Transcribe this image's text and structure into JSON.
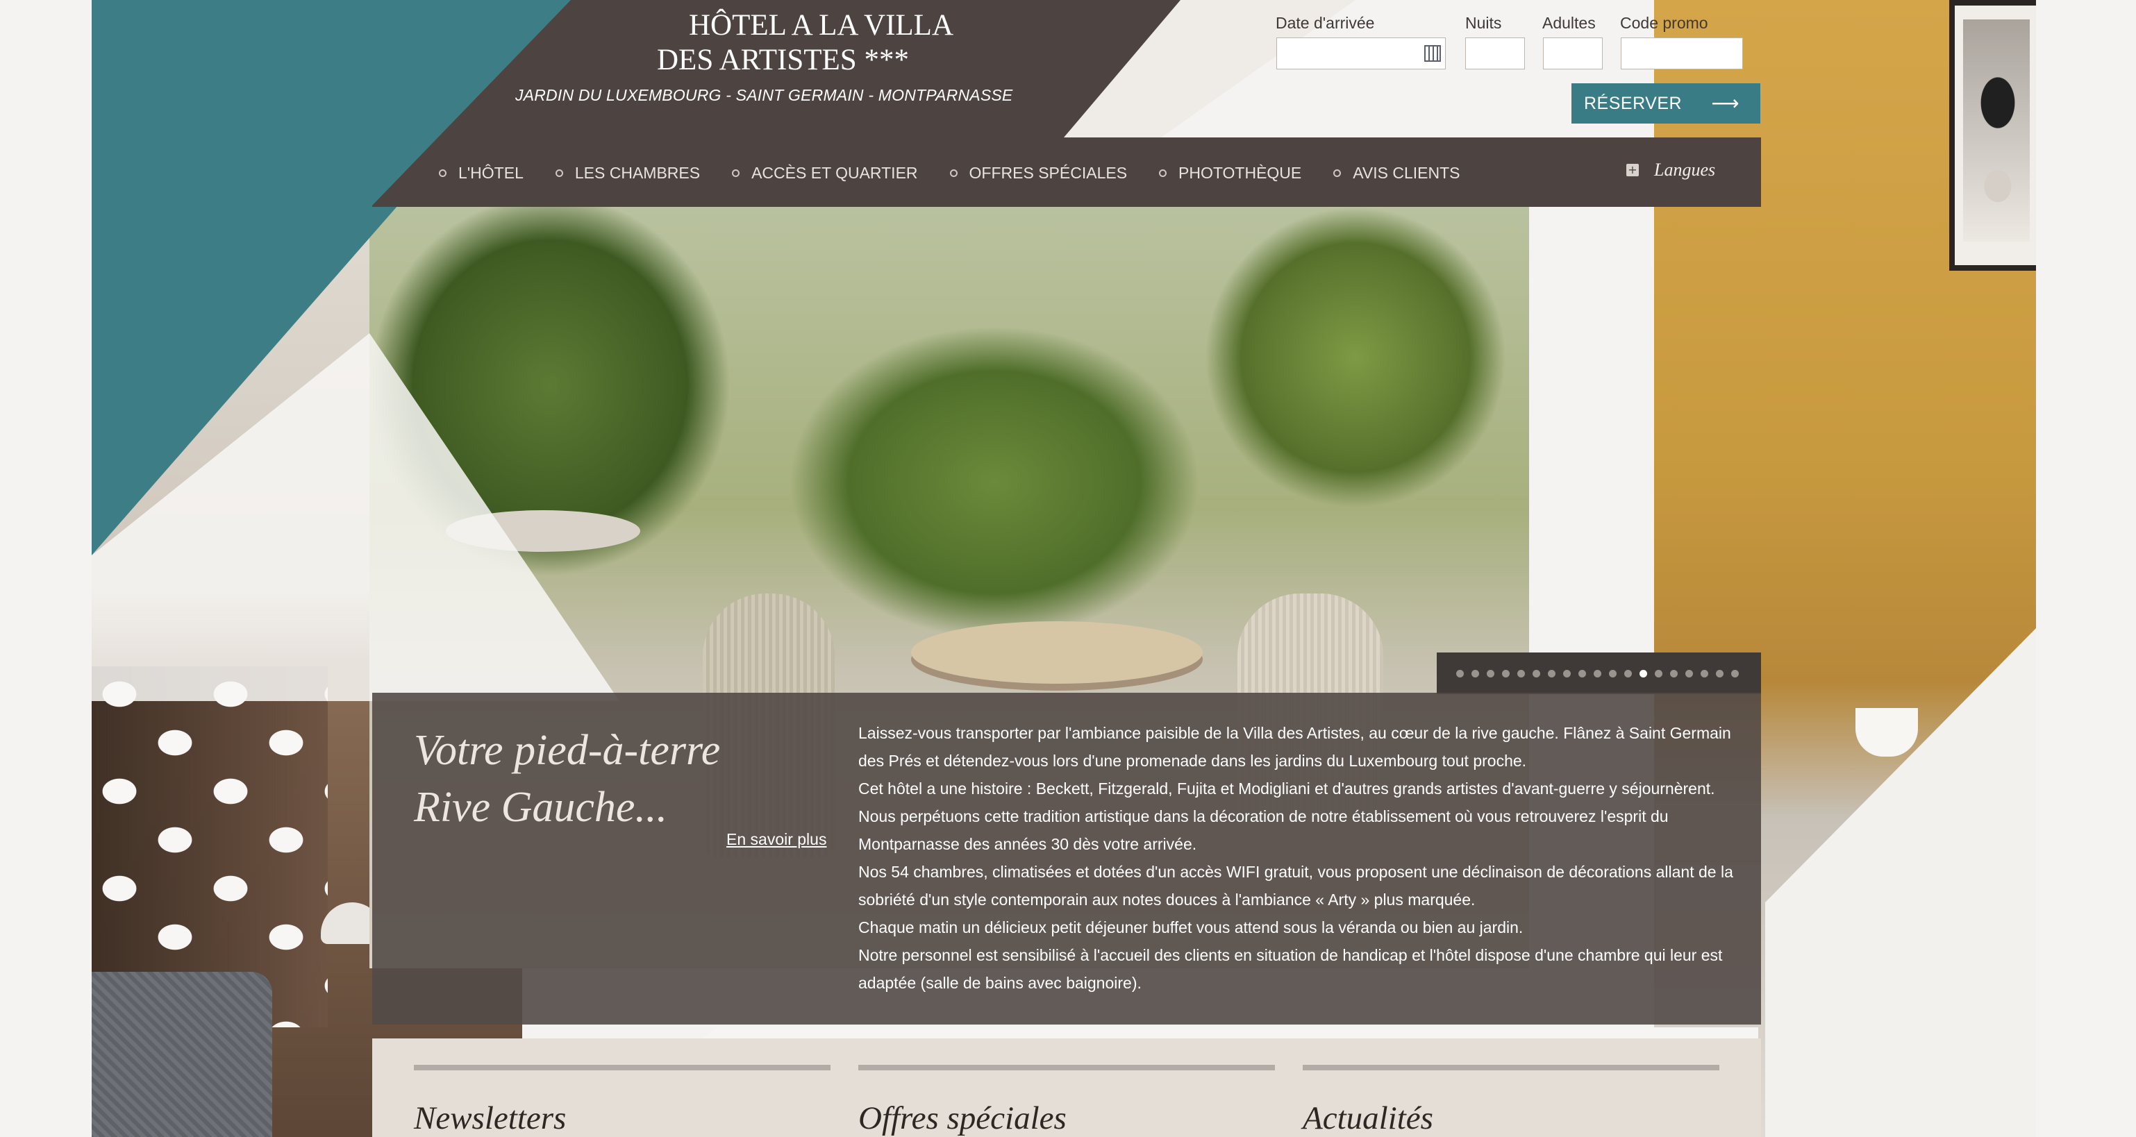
{
  "brand": {
    "title_line1": "HÔTEL A LA VILLA",
    "title_line2": "DES ARTISTES ***",
    "subtitle": "JARDIN DU LUXEMBOURG - SAINT GERMAIN - MONTPARNASSE"
  },
  "booking": {
    "arrival_label": "Date d'arrivée",
    "arrival_value": "",
    "nights_label": "Nuits",
    "nights_value": "",
    "adults_label": "Adultes",
    "adults_value": "",
    "promo_label": "Code promo",
    "promo_value": "",
    "calendar_icon": "calendar-icon",
    "submit_label": "RÉSERVER",
    "submit_arrow": "⟶"
  },
  "nav": {
    "items": [
      {
        "label": "L'HÔTEL"
      },
      {
        "label": "LES CHAMBRES"
      },
      {
        "label": "ACCÈS ET QUARTIER"
      },
      {
        "label": "OFFRES SPÉCIALES"
      },
      {
        "label": "PHOTOTHÈQUE"
      },
      {
        "label": "AVIS CLIENTS"
      }
    ],
    "languages_label": "Langues",
    "languages_icon": "+"
  },
  "slider": {
    "total": 19,
    "active_index": 12
  },
  "intro": {
    "tagline_line1": "Votre pied-à-terre",
    "tagline_line2": "Rive Gauche...",
    "more_link": "En savoir plus",
    "paragraphs": [
      "Laissez-vous transporter par l'ambiance paisible de la Villa des Artistes, au cœur de la rive gauche. Flânez à Saint Germain des Prés et détendez-vous lors d'une promenade dans les jardins du Luxembourg tout proche.",
      "Cet hôtel a une histoire : Beckett, Fitzgerald, Fujita et Modigliani et d'autres grands artistes d'avant-guerre y séjournèrent. Nous perpétuons cette tradition artistique dans la décoration de notre établissement où vous retrouverez l'esprit du Montparnasse des années 30 dès votre arrivée.",
      "Nos 54 chambres, climatisées et dotées d'un accès WIFI gratuit, vous proposent une déclinaison de décorations allant de la sobriété d'un style contemporain aux notes douces à l'ambiance « Arty » plus marquée.",
      "Chaque matin un délicieux petit déjeuner buffet vous attend sous la véranda ou bien au jardin.",
      "Notre personnel est sensibilisé à l'accueil des clients en situation de handicap et l'hôtel dispose d'une chambre qui leur est adaptée (salle de bains avec baignoire)."
    ]
  },
  "columns": {
    "newsletters": "Newsletters",
    "offers": "Offres spéciales",
    "news": "Actualités"
  },
  "colors": {
    "teal": "#3d7e86",
    "dark": "#4d4441",
    "button": "#3a7c86"
  }
}
